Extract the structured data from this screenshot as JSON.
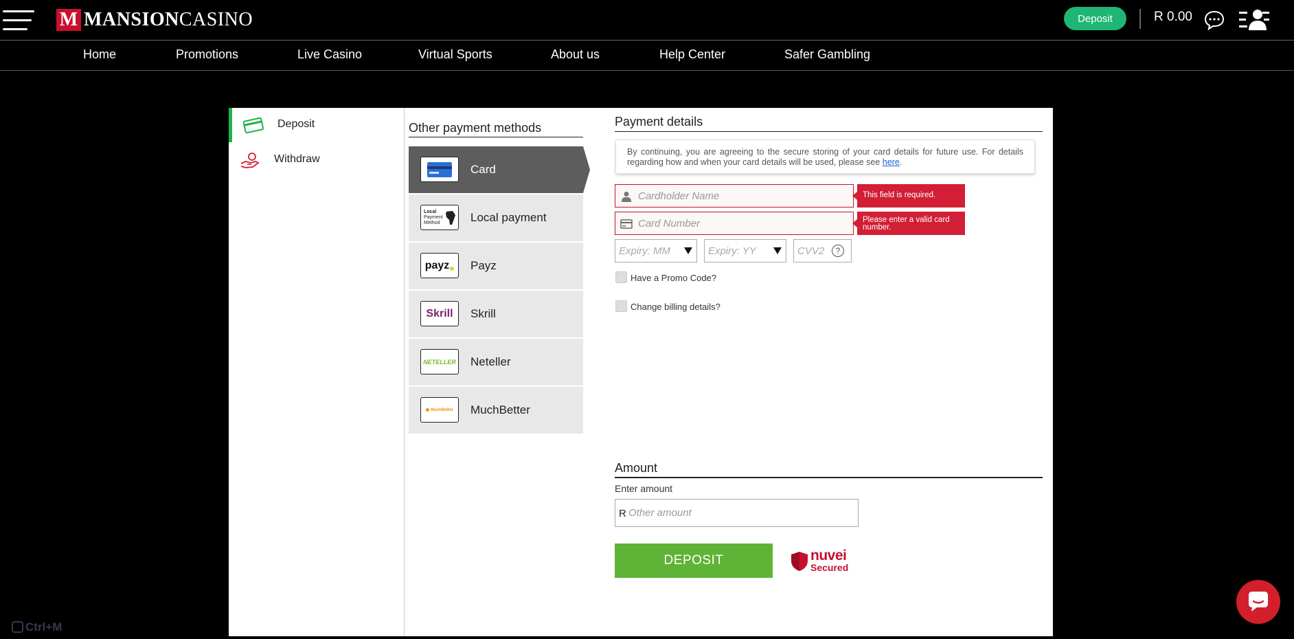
{
  "header": {
    "brand_mark": "M",
    "brand_name_bold": "MANSION",
    "brand_name_light": "CASINO",
    "deposit_label": "Deposit",
    "balance": "R 0.00"
  },
  "nav": [
    "Home",
    "Promotions",
    "Live Casino",
    "Virtual Sports",
    "About us",
    "Help Center",
    "Safer Gambling"
  ],
  "sidebar": [
    {
      "label": "Deposit",
      "icon": "card-icon"
    },
    {
      "label": "Withdraw",
      "icon": "hand-coin-icon"
    }
  ],
  "methods": {
    "title": "Other payment methods",
    "items": [
      {
        "label": "Card",
        "logo": "card-logo"
      },
      {
        "label": "Local payment",
        "logo": "local-payment-logo",
        "logo_text": [
          "Local",
          "Payment",
          "Method"
        ]
      },
      {
        "label": "Payz",
        "logo": "payz-logo",
        "logo_text": "payz"
      },
      {
        "label": "Skrill",
        "logo": "skrill-logo",
        "logo_text": "Skrill"
      },
      {
        "label": "Neteller",
        "logo": "neteller-logo",
        "logo_text": "NETELLER"
      },
      {
        "label": "MuchBetter",
        "logo": "muchbetter-logo",
        "logo_text": "MuchBetter"
      }
    ]
  },
  "payment": {
    "title": "Payment details",
    "notice_text": "By continuing, you are agreeing to the secure storing of your card details for future use. For details regarding how and when your card details will be used, please see ",
    "notice_link": "here",
    "notice_end": ".",
    "cardholder_placeholder": "Cardholder Name",
    "cardholder_error": "This field is required.",
    "card_number_placeholder": "Card Number",
    "card_number_error_1": "Please enter a valid card",
    "card_number_error_2": "number.",
    "expiry_mm": "Expiry: MM",
    "expiry_yy": "Expiry: YY",
    "cvv_placeholder": "CVV2",
    "cvv_help": "?",
    "promo_label": "Have a Promo Code?",
    "billing_label": "Change billing details?"
  },
  "amount": {
    "title": "Amount",
    "label": "Enter amount",
    "currency": "R",
    "placeholder": "Other amount",
    "deposit_button": "DEPOSIT",
    "secured_brand": "nuvei",
    "secured_text": "Secured"
  },
  "footer": {
    "shortcut": "Ctrl+M"
  },
  "colors": {
    "accent_green": "#22b14c",
    "deposit_button": "#5fb336",
    "header_deposit": "#1fb575",
    "error_red": "#d21f36",
    "brand_red": "#c8102e"
  }
}
